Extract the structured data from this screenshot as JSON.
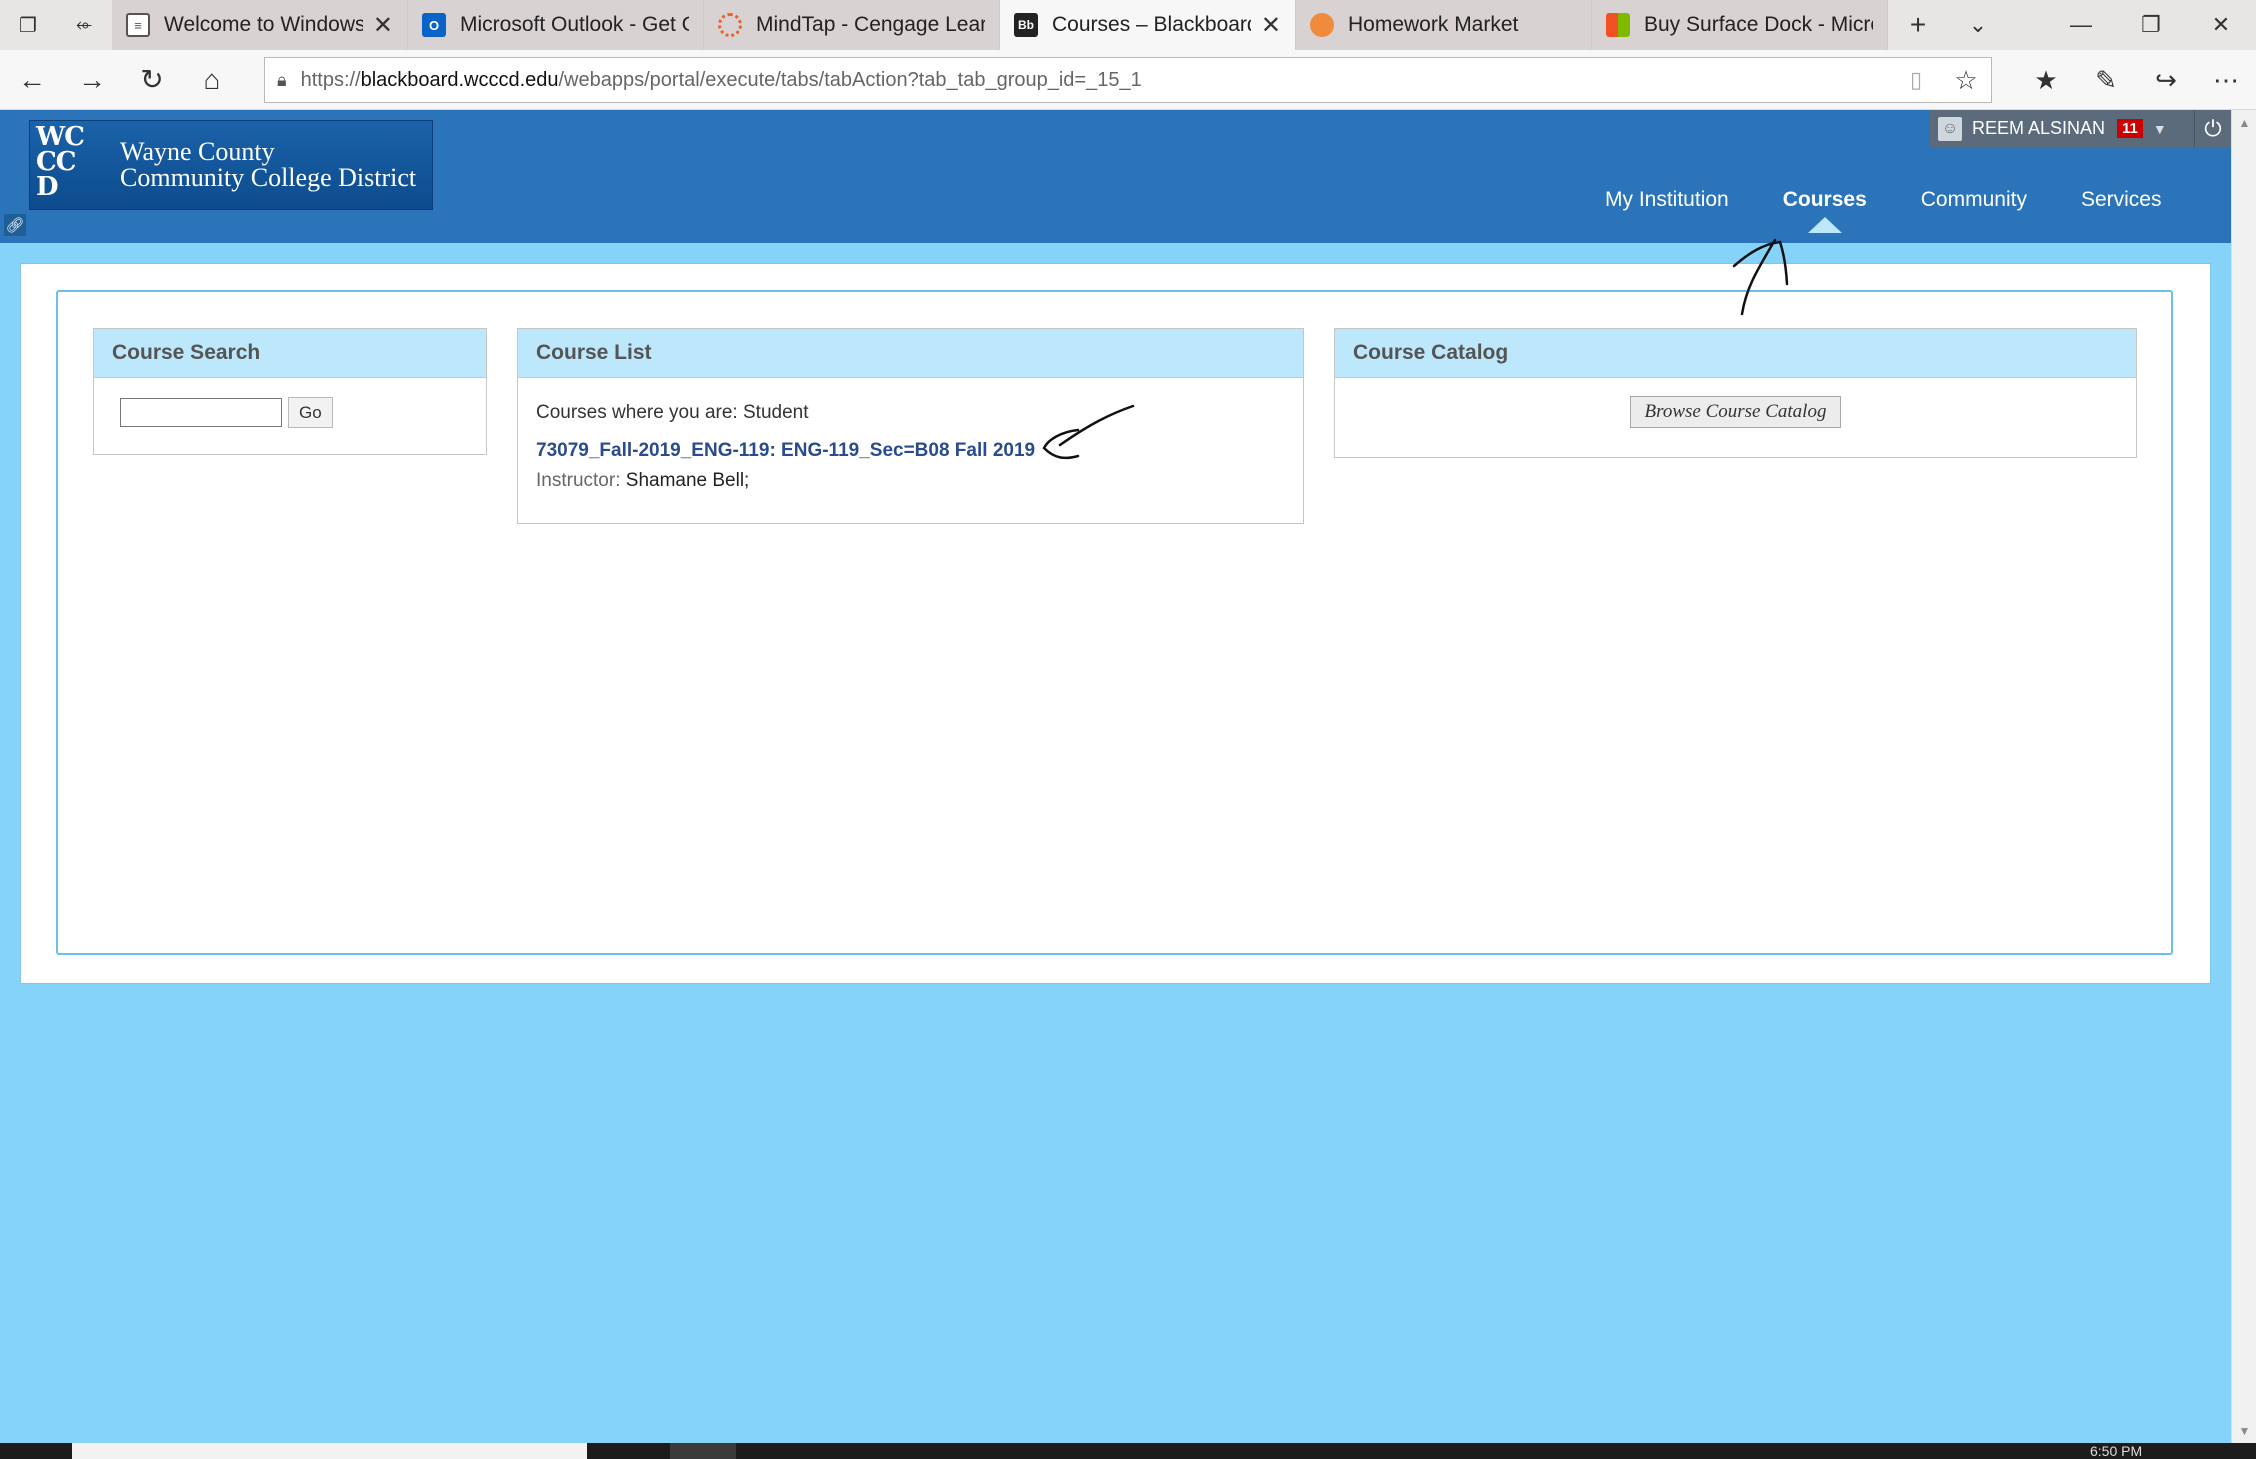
{
  "browser": {
    "tabs": [
      {
        "title": "Welcome to Windows",
        "icon": "windows-page-icon",
        "active": false,
        "closable": true
      },
      {
        "title": "Microsoft Outlook - Get Ou",
        "icon": "outlook-icon",
        "active": false,
        "closable": false
      },
      {
        "title": "MindTap - Cengage Learnir",
        "icon": "mindtap-icon",
        "active": false,
        "closable": false
      },
      {
        "title": "Courses – Blackboard L",
        "icon": "blackboard-icon",
        "active": true,
        "closable": true
      },
      {
        "title": "Homework Market",
        "icon": "homework-market-icon",
        "active": false,
        "closable": false
      },
      {
        "title": "Buy Surface Dock - Microsc",
        "icon": "microsoft-icon",
        "active": false,
        "closable": false
      }
    ],
    "new_tab": "+",
    "url_prefix": "https://",
    "url_host": "blackboard.wcccd.edu",
    "url_path": "/webapps/portal/execute/tabs/tabAction?tab_tab_group_id=_15_1"
  },
  "header": {
    "logo_mark_lines": [
      "WC",
      "CC",
      "D"
    ],
    "logo_line1": "Wayne County",
    "logo_line2": "Community College District",
    "user_name": "REEM ALSINAN",
    "notification_count": "11",
    "nav": [
      {
        "label": "My Institution",
        "active": false
      },
      {
        "label": "Courses",
        "active": true
      },
      {
        "label": "Community",
        "active": false
      },
      {
        "label": "Services",
        "active": false
      }
    ]
  },
  "modules": {
    "search": {
      "title": "Course Search",
      "go_label": "Go",
      "value": ""
    },
    "list": {
      "title": "Course List",
      "role_line": "Courses where you are: Student",
      "course_link": "73079_Fall-2019_ENG-119: ENG-119_Sec=B08 Fall 2019",
      "instructor_label": "Instructor:",
      "instructor_name": "Shamane Bell;"
    },
    "catalog": {
      "title": "Course Catalog",
      "button_label": "Browse Course Catalog"
    }
  },
  "taskbar": {
    "clock": "6:50 PM"
  },
  "colors": {
    "header_blue": "#2b74b9",
    "page_bg": "#85d3f8",
    "module_title_bg": "#bde8fb",
    "link": "#2a4b8d",
    "badge_red": "#cc0000"
  }
}
